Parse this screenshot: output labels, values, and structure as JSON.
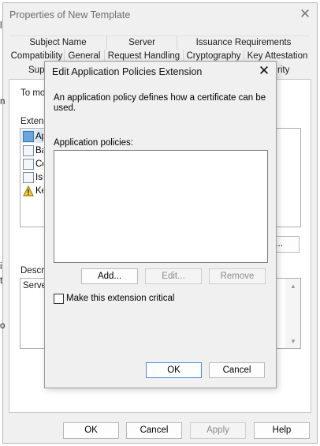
{
  "main_window": {
    "title": "Properties of New Template",
    "close_glyph": "✕",
    "tabs_row1": [
      "Subject Name",
      "Server",
      "Issuance Requirements"
    ],
    "tabs_row2": [
      "Compatibility",
      "General",
      "Request Handling",
      "Cryptography",
      "Key Attestation"
    ],
    "tabs_row3": [
      "Sup",
      "rity"
    ],
    "left_edge_chars": [
      "l",
      "n",
      "i",
      "t",
      "o"
    ],
    "to_modify_label": "To mod",
    "extensions_label": "Extens",
    "extensions": [
      "Ap",
      "Ba",
      "Ce",
      "Iss",
      "Ke"
    ],
    "edit_button_label": "...",
    "description_label": "Descrip",
    "description_value": "Server",
    "buttons": {
      "ok": "OK",
      "cancel": "Cancel",
      "apply": "Apply",
      "help": "Help"
    }
  },
  "dialog": {
    "title": "Edit Application Policies Extension",
    "close_glyph": "✕",
    "description": "An application policy defines how a certificate can be used.",
    "policies_label": "Application policies:",
    "policies": [],
    "add_label": "Add...",
    "edit_label": "Edit...",
    "remove_label": "Remove",
    "critical_label": "Make this extension critical",
    "ok_label": "OK",
    "cancel_label": "Cancel"
  },
  "icons": {
    "scroll_up": "▲",
    "scroll_down": "▼"
  }
}
